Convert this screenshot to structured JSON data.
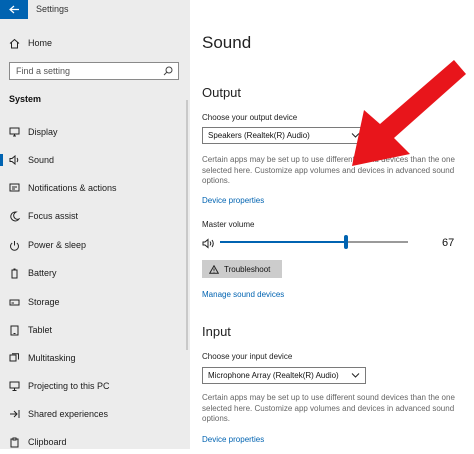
{
  "app": {
    "title": "Settings",
    "back_icon": "back-arrow-icon"
  },
  "sidebar": {
    "home_label": "Home",
    "search_placeholder": "Find a setting",
    "section_title": "System",
    "items": [
      {
        "label": "Display",
        "icon": "display-icon"
      },
      {
        "label": "Sound",
        "icon": "speaker-icon",
        "active": true
      },
      {
        "label": "Notifications & actions",
        "icon": "notifications-icon"
      },
      {
        "label": "Focus assist",
        "icon": "moon-icon"
      },
      {
        "label": "Power & sleep",
        "icon": "power-icon"
      },
      {
        "label": "Battery",
        "icon": "battery-icon"
      },
      {
        "label": "Storage",
        "icon": "storage-icon"
      },
      {
        "label": "Tablet",
        "icon": "tablet-icon"
      },
      {
        "label": "Multitasking",
        "icon": "multitasking-icon"
      },
      {
        "label": "Projecting to this PC",
        "icon": "projecting-icon"
      },
      {
        "label": "Shared experiences",
        "icon": "shared-icon"
      },
      {
        "label": "Clipboard",
        "icon": "clipboard-icon"
      }
    ]
  },
  "main": {
    "title": "Sound",
    "output": {
      "heading": "Output",
      "device_label": "Choose your output device",
      "device_value": "Speakers (Realtek(R) Audio)",
      "description": "Certain apps may be set up to use different sound devices than the one selected here. Customize app volumes and devices in advanced sound options.",
      "properties_link": "Device properties",
      "volume_label": "Master volume",
      "volume_value": "67",
      "volume_level": 0.67,
      "troubleshoot_label": "Troubleshoot",
      "manage_link": "Manage sound devices"
    },
    "input": {
      "heading": "Input",
      "device_label": "Choose your input device",
      "device_value": "Microphone Array (Realtek(R) Audio)",
      "description": "Certain apps may be set up to use different sound devices than the one selected here. Customize app volumes and devices in advanced sound options.",
      "properties_link": "Device properties"
    }
  },
  "colors": {
    "accent": "#0063b1",
    "annotation_arrow": "#e8151b",
    "sidebar_bg": "#ececec"
  }
}
